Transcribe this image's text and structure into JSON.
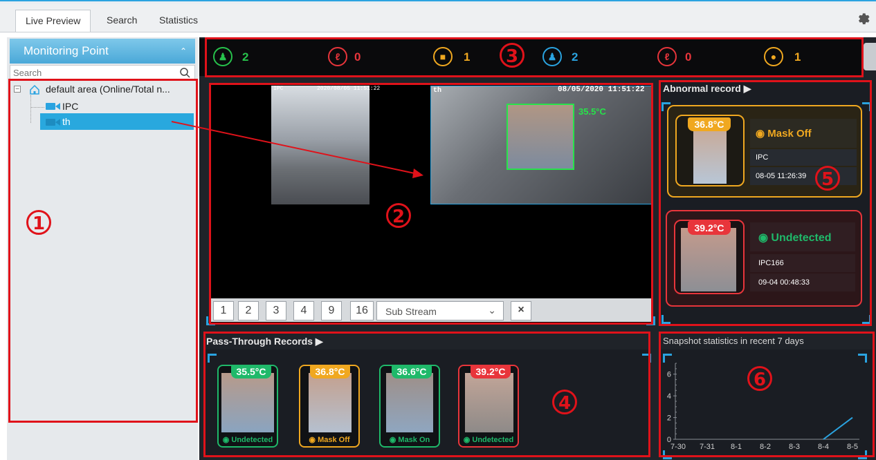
{
  "tabs": [
    {
      "label": "Live Preview"
    },
    {
      "label": "Search"
    },
    {
      "label": "Statistics"
    }
  ],
  "sidebar": {
    "title": "Monitoring Point",
    "search_placeholder": "Search",
    "tree": {
      "root_label": "default area (Online/Total n...",
      "items": [
        {
          "label": "IPC",
          "icon": "camera-icon"
        },
        {
          "label": "th",
          "icon": "camera-icon"
        }
      ]
    }
  },
  "stats": [
    {
      "icon": "people-icon",
      "value": "2",
      "color": "#27c24c"
    },
    {
      "icon": "thermometer-icon",
      "value": "0",
      "color": "#e8353b"
    },
    {
      "icon": "mask-off-icon",
      "value": "1",
      "color": "#f0a820"
    },
    {
      "icon": "people-icon",
      "value": "2",
      "color": "#2aa3e0"
    },
    {
      "icon": "thermometer-icon",
      "value": "0",
      "color": "#e8353b"
    },
    {
      "icon": "mask-icon",
      "value": "1",
      "color": "#f0a820"
    }
  ],
  "video": {
    "ch1_name": "IPC",
    "ch1_time": "2020/08/05 11:51:22",
    "ch2_name": "th",
    "ch2_time": "08/05/2020 11:51:22",
    "face_temp": "35.5°C"
  },
  "controls": {
    "layouts": [
      "1",
      "2",
      "3",
      "4",
      "9",
      "16"
    ],
    "stream": "Sub Stream"
  },
  "abnormal": {
    "title": "Abnormal record",
    "records": [
      {
        "temp": "36.8°C",
        "status": "Mask Off",
        "camera": "IPC",
        "time": "08-05 11:26:39",
        "color": "#f0a820"
      },
      {
        "temp": "39.2°C",
        "status": "Undetected",
        "camera": "IPC166",
        "time": "09-04 00:48:33",
        "color": "#e8353b"
      }
    ]
  },
  "pass_through": {
    "title": "Pass-Through Records",
    "records": [
      {
        "temp": "35.5°C",
        "status": "Undetected",
        "color": "#1fb96a"
      },
      {
        "temp": "36.8°C",
        "status": "Mask Off",
        "color": "#f0a820"
      },
      {
        "temp": "36.6°C",
        "status": "Mask On",
        "color": "#1fb96a"
      },
      {
        "temp": "39.2°C",
        "status": "Undetected",
        "color": "#e8353b"
      }
    ]
  },
  "snapshot": {
    "title": "Snapshot statistics in recent 7 days"
  },
  "chart_data": {
    "type": "line",
    "title": "",
    "x": [
      "7-30",
      "7-31",
      "8-1",
      "8-2",
      "8-3",
      "8-4",
      "8-5"
    ],
    "series": [
      {
        "values": [
          0,
          0,
          0,
          0,
          0,
          0,
          2
        ]
      }
    ],
    "yticks": [
      "0",
      "2",
      "4",
      "6"
    ],
    "ylim": [
      0,
      7
    ],
    "line_color": "#2aa3e0"
  },
  "annotations": [
    "1",
    "2",
    "3",
    "4",
    "5",
    "6"
  ]
}
